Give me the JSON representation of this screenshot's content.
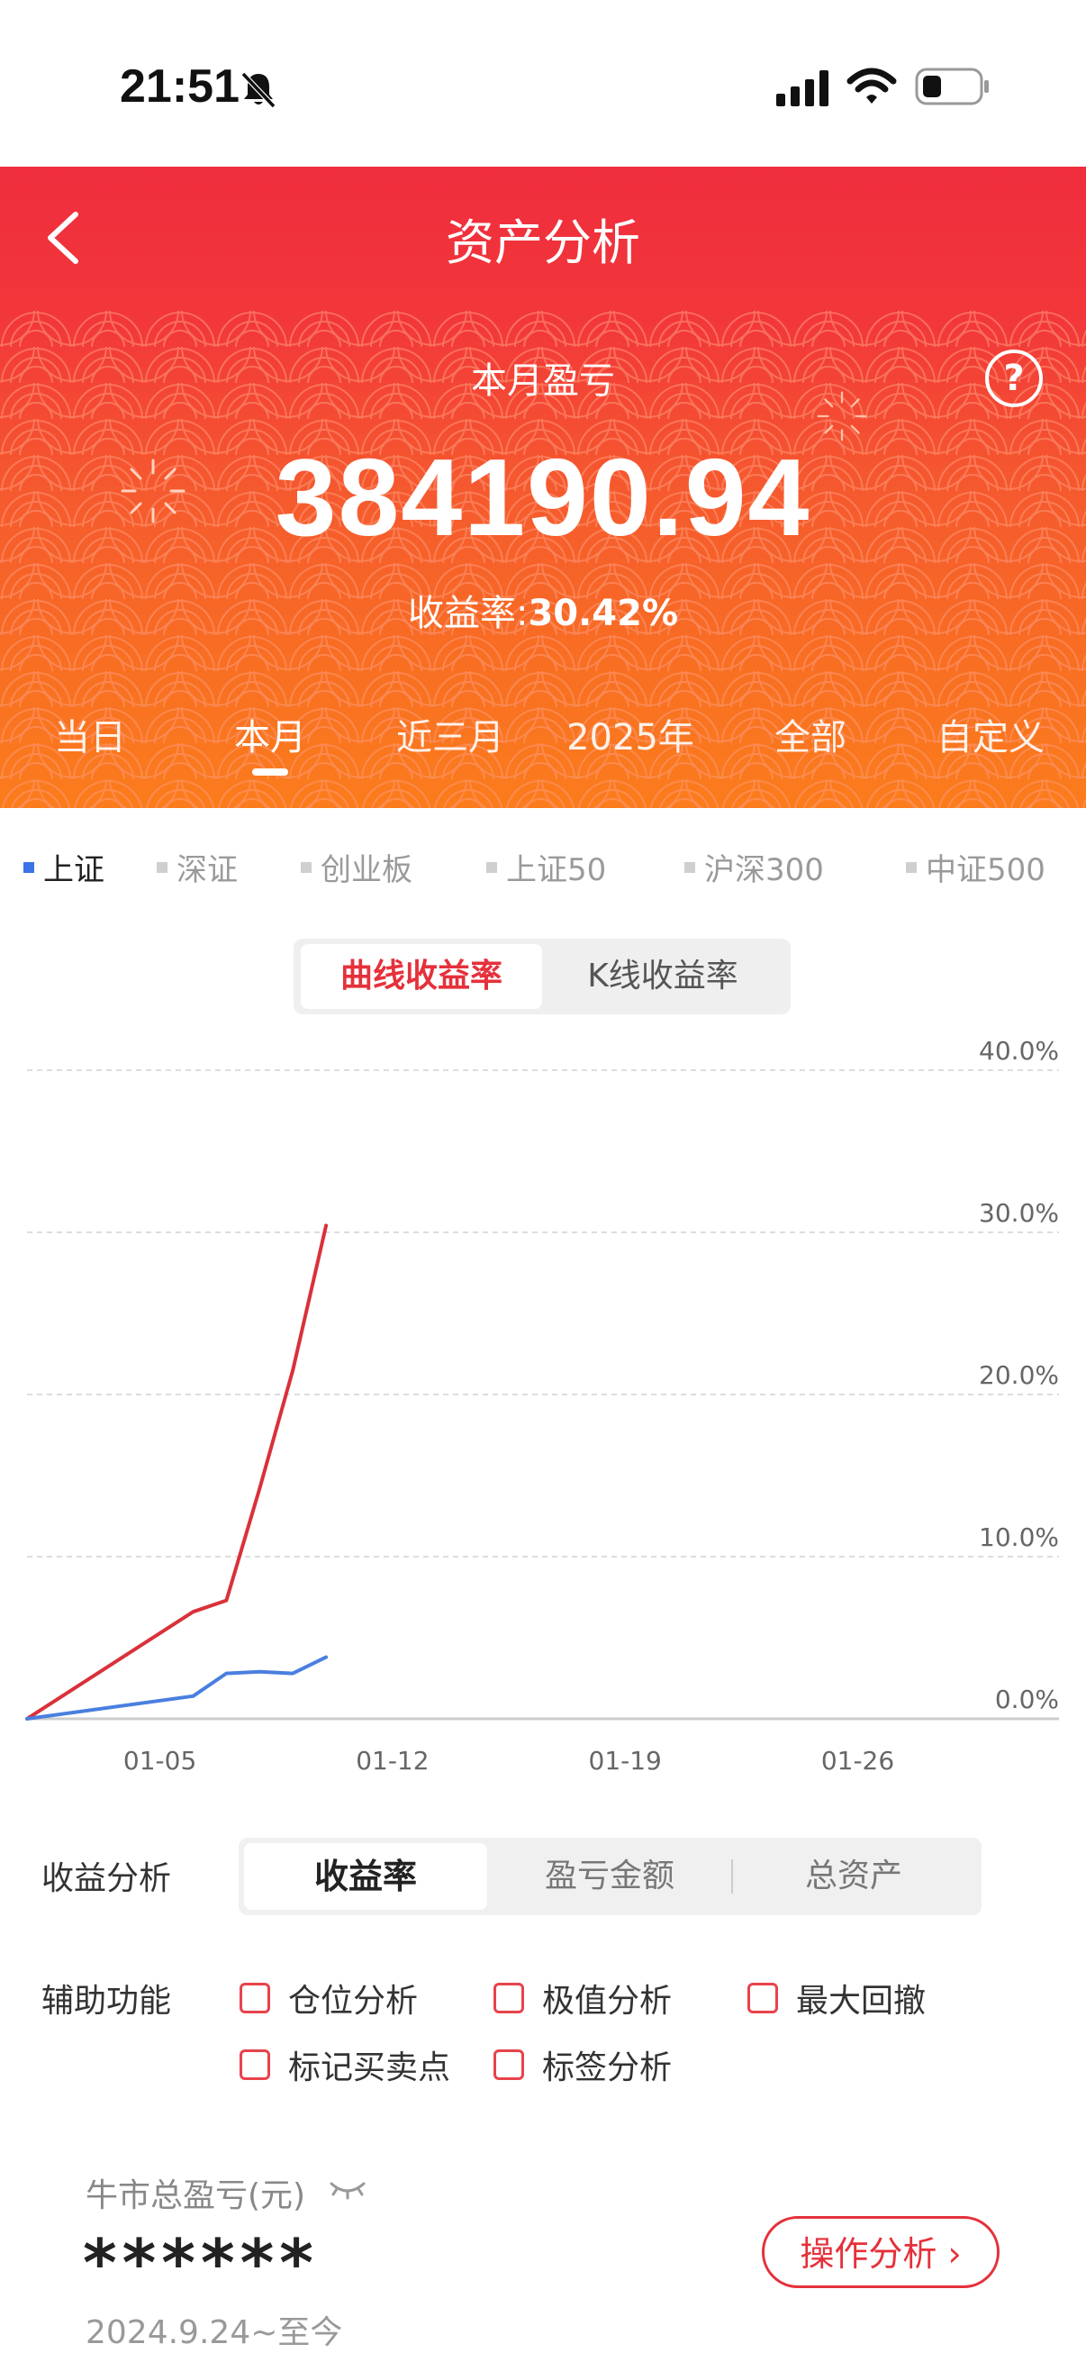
{
  "status_bar": {
    "time": "21:51",
    "icons": [
      "bell-slash-icon",
      "signal-icon",
      "wifi-icon",
      "battery-icon"
    ]
  },
  "header": {
    "title": "资产分析",
    "back_icon": "chevron-left-icon"
  },
  "summary": {
    "label": "本月盈亏",
    "help_icon": "?",
    "pnl_value": "384190.94",
    "yield_label": "收益率:",
    "yield_value": "30.42%"
  },
  "period_tabs": [
    {
      "label": "当日"
    },
    {
      "label": "本月",
      "active": true
    },
    {
      "label": "近三月"
    },
    {
      "label": "2025年"
    },
    {
      "label": "全部"
    },
    {
      "label": "自定义"
    }
  ],
  "index_tabs": [
    {
      "label": "上证",
      "active": true
    },
    {
      "label": "深证"
    },
    {
      "label": "创业板"
    },
    {
      "label": "上证50"
    },
    {
      "label": "沪深300"
    },
    {
      "label": "中证500"
    }
  ],
  "chart_mode": {
    "active": "曲线收益率",
    "other": "K线收益率"
  },
  "chart_data": {
    "type": "line",
    "x_ticks": [
      "01-05",
      "01-12",
      "01-19",
      "01-26"
    ],
    "y_ticks": [
      "40.0%",
      "30.0%",
      "20.0%",
      "10.0%",
      "0.0%"
    ],
    "ylim": [
      0,
      40
    ],
    "grid": true,
    "series": [
      {
        "color": "#d9313a",
        "x": [
          "01-01",
          "01-06",
          "01-07",
          "01-08",
          "01-09",
          "01-10"
        ],
        "values": [
          0,
          6.6,
          7.3,
          14.2,
          21.5,
          30.42
        ]
      },
      {
        "color": "#4a7fe0",
        "x": [
          "01-01",
          "01-06",
          "01-07",
          "01-08",
          "01-09",
          "01-10"
        ],
        "values": [
          0,
          1.4,
          2.8,
          2.9,
          2.8,
          3.8
        ]
      }
    ]
  },
  "analysis": {
    "label": "收益分析",
    "options": [
      "收益率",
      "盈亏金额",
      "总资产"
    ],
    "active": "收益率"
  },
  "aux": {
    "label": "辅助功能",
    "options": [
      "仓位分析",
      "极值分析",
      "最大回撤",
      "标记买卖点",
      "标签分析"
    ]
  },
  "bull": {
    "label": "牛市总盈亏(元)",
    "eye_icon": "eye-closed-icon",
    "value": "******",
    "date": "2024.9.24~至今",
    "button": "操作分析 ›"
  },
  "colors": {
    "accent_red": "#e5313b",
    "index_blue": "#3a74e6"
  }
}
